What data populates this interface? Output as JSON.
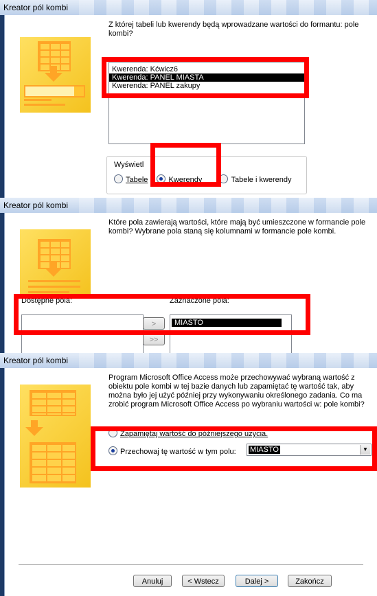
{
  "dialogs": [
    {
      "title": "Kreator pól kombi",
      "prompt": "Z której tabeli lub kwerendy będą wprowadzane wartości do formantu: pole kombi?",
      "list": [
        {
          "label": "Kwerenda: Kćwicz6",
          "selected": false
        },
        {
          "label": "Kwerenda: PANEL MIASTA",
          "selected": true
        },
        {
          "label": "Kwerenda: PANEL zakupy",
          "selected": false
        }
      ],
      "view_group_label": "Wyświetl",
      "radios": [
        {
          "label": "Tabele",
          "selected": false
        },
        {
          "label": "Kwerendy",
          "selected": true
        },
        {
          "label": "Tabele i kwerendy",
          "selected": false
        }
      ]
    },
    {
      "title": "Kreator pól kombi",
      "prompt": "Które pola zawierają wartości, które mają być umieszczone w formancie pole kombi? Wybrane pola staną się kolumnami w formancie pole kombi.",
      "available_label": "Dostępne pola:",
      "selected_label": "Zaznaczone pola:",
      "selected_fields": [
        "MIASTO"
      ],
      "move_one": ">",
      "move_all": ">>"
    },
    {
      "title": "Kreator pól kombi",
      "prompt": "Program Microsoft Office Access może przechowywać wybraną wartość z obiektu pole kombi w tej bazie danych lub zapamiętać tę wartość tak, aby można było jej użyć później przy wykonywaniu określonego zadania. Co ma zrobić program Microsoft Office Access po wybraniu wartości w: pole kombi?",
      "option1": "Zapamiętaj wartość do późniejszego użycia.",
      "option2": "Przechowaj tę wartość w tym polu:",
      "field_value": "MIASTO",
      "buttons": {
        "cancel": "Anuluj",
        "back": "< Wstecz",
        "next": "Dalej >",
        "finish": "Zakończ"
      }
    }
  ],
  "colors": {
    "highlight": "#ff0000",
    "art": "#f4c21e"
  }
}
